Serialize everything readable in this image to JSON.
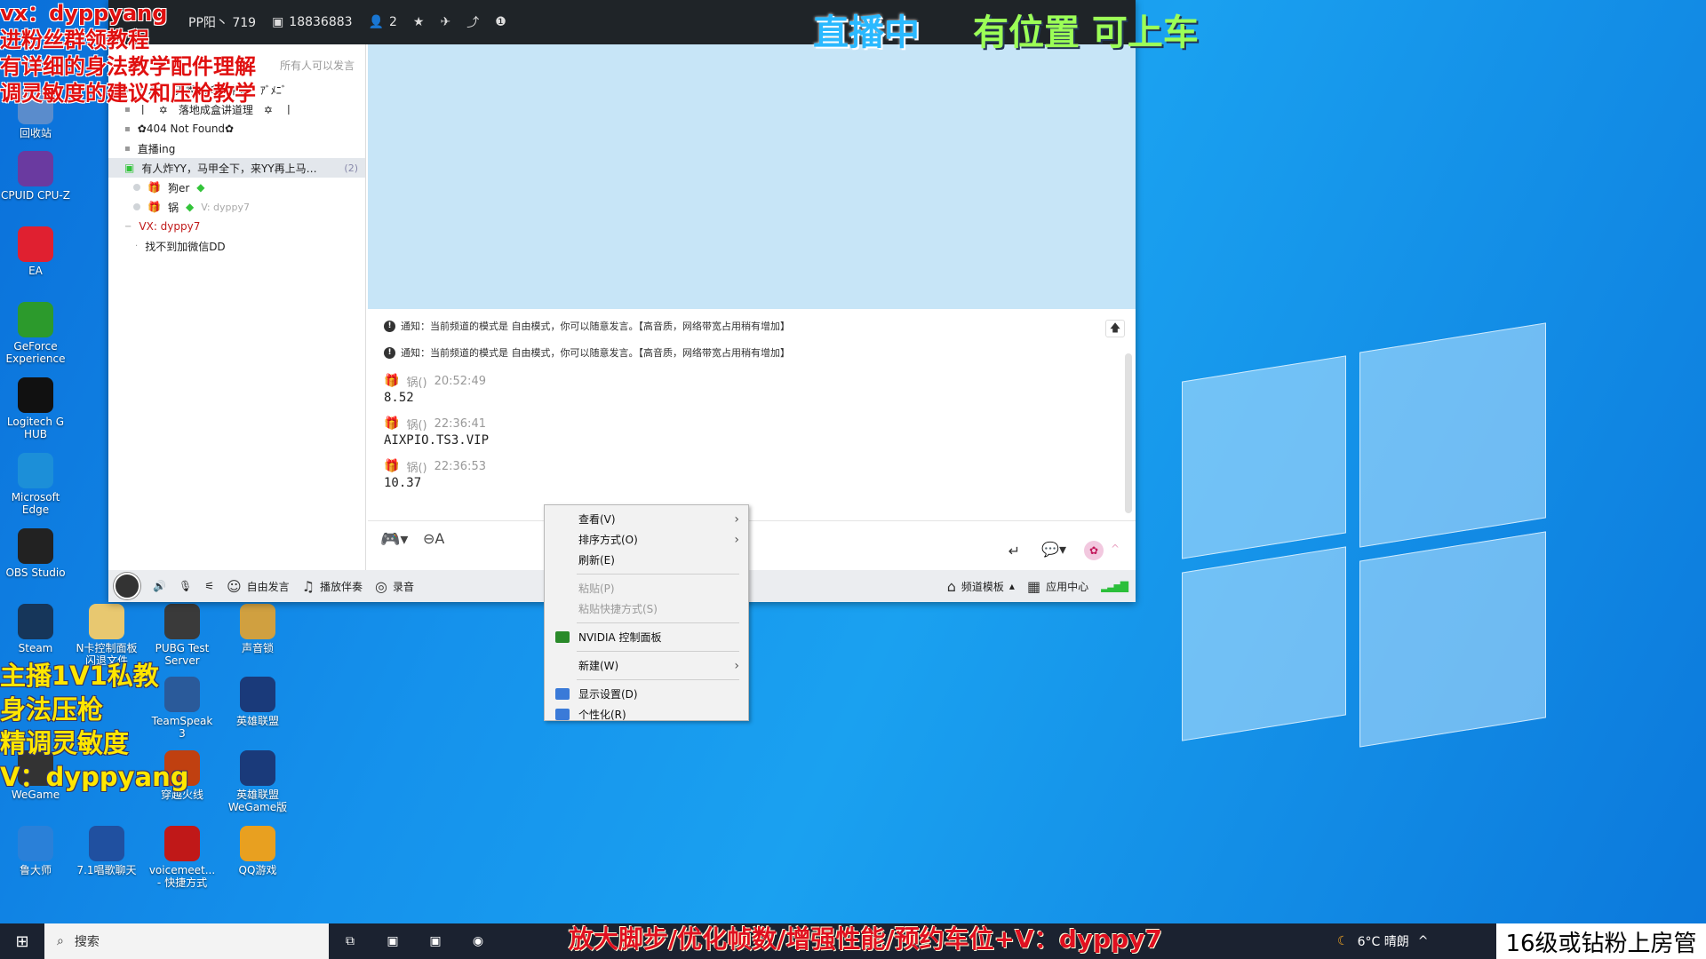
{
  "overlay": {
    "red_lines": [
      "vx：dyppyang",
      "进粉丝群领教程",
      "有详细的身法教学配件理解",
      "调灵敏度的建议和压枪教学"
    ],
    "yellow_lines": [
      "主播1V1私教",
      "身法压枪",
      "精调灵敏度",
      "V：dyppyang"
    ],
    "live_a": "直播中",
    "live_b": "有位置 可上车",
    "bottom_banner": "放大脚步/优化帧数/增强性能/预约车位+V：dyppy7",
    "corner_text": "16级或钻粉上房管"
  },
  "desktop_icons": [
    {
      "label": "回收站",
      "color": "#5a8ccc"
    },
    {
      "label": "CPUID CPU-Z",
      "color": "#6a3aa0"
    },
    {
      "label": "EA",
      "color": "#e02030"
    },
    {
      "label": "GeForce Experience",
      "color": "#2c9a2c"
    },
    {
      "label": "Logitech G HUB",
      "color": "#111111"
    },
    {
      "label": "Microsoft Edge",
      "color": "#1c8fd8"
    },
    {
      "label": "OBS Studio",
      "color": "#222222"
    },
    {
      "label": "Steam",
      "color": "#16365a"
    },
    {
      "label": "N卡控制面板 闪退文件",
      "color": "#e8c870"
    },
    {
      "label": "PUBG Test Server",
      "color": "#3a3a3a"
    },
    {
      "label": "声音锁",
      "color": "#d0a040"
    },
    {
      "label": "TeamSpeak 3",
      "color": "#2a5a9a"
    },
    {
      "label": "英雄联盟",
      "color": "#1a3a7a"
    },
    {
      "label": "WeGame",
      "color": "#333333"
    },
    {
      "label": "穿越火线",
      "color": "#c04010"
    },
    {
      "label": "英雄联盟 WeGame版",
      "color": "#1a3a7a"
    },
    {
      "label": "鲁大师",
      "color": "#2a80d8"
    },
    {
      "label": "7.1唱歌聊天",
      "color": "#2050a0"
    },
    {
      "label": "voicemeet... - 快捷方式",
      "color": "#c01818"
    },
    {
      "label": "QQ游戏",
      "color": "#e8a020"
    }
  ],
  "ts": {
    "title_stats": {
      "name": "PP阳丶 719",
      "id": "18836883",
      "users": "2"
    },
    "left_header": "所有人可以发言",
    "tree": [
      {
        "text": "ｱﾞﾒﾆﾞ　天秀吃鸡吹牛逼　ｱﾞﾒﾆﾞ",
        "kind": "channel-lock"
      },
      {
        "text": "丨　✡　落地成盒讲道理　✡　丨",
        "kind": "channel"
      },
      {
        "text": "✿404 Not Found✿",
        "kind": "channel-lock"
      },
      {
        "text": "直播ing",
        "kind": "channel-lock"
      },
      {
        "text": "有人炸YY，马甲全下，来YY再上马…",
        "count": "(2)",
        "kind": "channel-sel"
      },
      {
        "text": "狗er",
        "kind": "user-gold"
      },
      {
        "text": "锅",
        "sub": "V: dyppy7",
        "kind": "user-gift"
      },
      {
        "text": "VX: dyppy7",
        "kind": "group-red"
      },
      {
        "text": "找不到加微信DD",
        "kind": "sub"
      }
    ],
    "notice_text": "通知：当前频道的模式是 自由模式，你可以随意发言。【高音质，网络带宽占用稍有增加】",
    "messages": [
      {
        "user": "锅()",
        "time": "20:52:49",
        "body": "8.52"
      },
      {
        "user": "锅()",
        "time": "22:36:41",
        "body": "AIXPIO.TS3.VIP"
      },
      {
        "user": "锅()",
        "time": "22:36:53",
        "body": "10.37"
      }
    ],
    "toolbar": {
      "free_speak": "自由发言",
      "play_music": "播放伴奏",
      "record": "录音",
      "template": "频道模板",
      "app_center": "应用中心"
    }
  },
  "context_menu": {
    "items": [
      {
        "label": "查看(V)",
        "arrow": true
      },
      {
        "label": "排序方式(O)",
        "arrow": true
      },
      {
        "label": "刷新(E)"
      },
      {
        "sep": true
      },
      {
        "label": "粘贴(P)",
        "disabled": true
      },
      {
        "label": "粘贴快捷方式(S)",
        "disabled": true
      },
      {
        "sep": true
      },
      {
        "label": "NVIDIA 控制面板",
        "icon": "#2a8a2a"
      },
      {
        "sep": true
      },
      {
        "label": "新建(W)",
        "arrow": true
      },
      {
        "sep": true
      },
      {
        "label": "显示设置(D)",
        "icon": "#3a7ad8"
      },
      {
        "label": "个性化(R)",
        "icon": "#3a7ad8"
      }
    ]
  },
  "taskbar": {
    "search_placeholder": "搜索",
    "weather": "6°C 晴朗"
  }
}
